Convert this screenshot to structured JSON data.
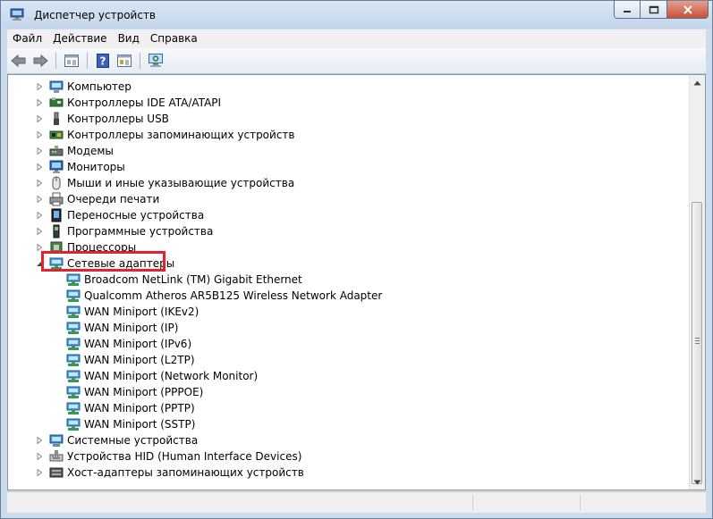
{
  "window": {
    "title": "Диспетчер устройств"
  },
  "menu": [
    "Файл",
    "Действие",
    "Вид",
    "Справка"
  ],
  "toolbar": [
    "back-icon",
    "forward-icon",
    "properties-icon",
    "help-icon",
    "update-icon",
    "scan-hardware-icon"
  ],
  "tree": {
    "before": [
      {
        "label": "Компьютер",
        "icon": "computer-icon"
      },
      {
        "label": "Контроллеры IDE ATA/ATAPI",
        "icon": "ide-icon"
      },
      {
        "label": "Контроллеры USB",
        "icon": "usb-icon"
      },
      {
        "label": "Контроллеры запоминающих устройств",
        "icon": "storage-icon"
      },
      {
        "label": "Модемы",
        "icon": "modem-icon"
      },
      {
        "label": "Мониторы",
        "icon": "monitor-icon"
      },
      {
        "label": "Мыши и иные указывающие устройства",
        "icon": "mouse-icon"
      },
      {
        "label": "Очереди печати",
        "icon": "printer-icon"
      },
      {
        "label": "Переносные устройства",
        "icon": "portable-device-icon"
      },
      {
        "label": "Программные устройства",
        "icon": "software-device-icon"
      },
      {
        "label": "Процессоры",
        "icon": "processor-icon"
      }
    ],
    "expanded": {
      "label": "Сетевые адаптеры",
      "icon": "network-adapter-icon",
      "children": [
        "Broadcom NetLink (TM) Gigabit Ethernet",
        "Qualcomm Atheros AR5B125 Wireless Network Adapter",
        "WAN Miniport (IKEv2)",
        "WAN Miniport (IP)",
        "WAN Miniport (IPv6)",
        "WAN Miniport (L2TP)",
        "WAN Miniport (Network Monitor)",
        "WAN Miniport (PPPOE)",
        "WAN Miniport (PPTP)",
        "WAN Miniport (SSTP)"
      ]
    },
    "after": [
      {
        "label": "Системные устройства",
        "icon": "system-device-icon"
      },
      {
        "label": "Устройства HID (Human Interface Devices)",
        "icon": "hid-icon"
      },
      {
        "label": "Хост-адаптеры запоминающих устройств",
        "icon": "storage-host-icon"
      }
    ]
  },
  "colors": {
    "highlight": "#e3222e",
    "frame": "#cddcec"
  }
}
